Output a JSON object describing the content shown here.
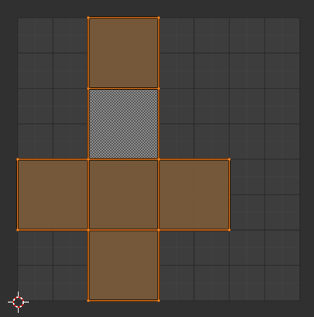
{
  "editor": {
    "type": "UV Editor",
    "background_color": "#303030",
    "image_area_color": "#3d3d3d",
    "grid_line_color": "#484848",
    "major_grid_line_color": "#262626",
    "uv_range_u": [
      0,
      1
    ],
    "uv_range_v": [
      0,
      1
    ],
    "grid_subdivisions": 8
  },
  "uv_islands": {
    "layout": "cube-cross-unwrap",
    "face_fill_color": "#7a5a3a",
    "selected_edge_color": "#e8731a",
    "vertex_color": "#ff8a25",
    "faces": [
      {
        "name": "top-face",
        "u": [
          0.25,
          0.5
        ],
        "v": [
          0.75,
          1.0
        ],
        "selected": true
      },
      {
        "name": "back-face",
        "u": [
          0.25,
          0.5
        ],
        "v": [
          0.5,
          0.75
        ],
        "selected": false
      },
      {
        "name": "left-face",
        "u": [
          0.0,
          0.25
        ],
        "v": [
          0.25,
          0.5
        ],
        "selected": true
      },
      {
        "name": "front-face",
        "u": [
          0.25,
          0.5
        ],
        "v": [
          0.25,
          0.5
        ],
        "selected": true
      },
      {
        "name": "right-face",
        "u": [
          0.5,
          0.75
        ],
        "v": [
          0.25,
          0.5
        ],
        "selected": true
      },
      {
        "name": "bottom-face",
        "u": [
          0.25,
          0.5
        ],
        "v": [
          0.0,
          0.25
        ],
        "selected": true
      }
    ]
  },
  "cursor": {
    "icon": "2d-cursor-icon",
    "ring_color_a": "#ffffff",
    "ring_color_b": "#e01010"
  }
}
